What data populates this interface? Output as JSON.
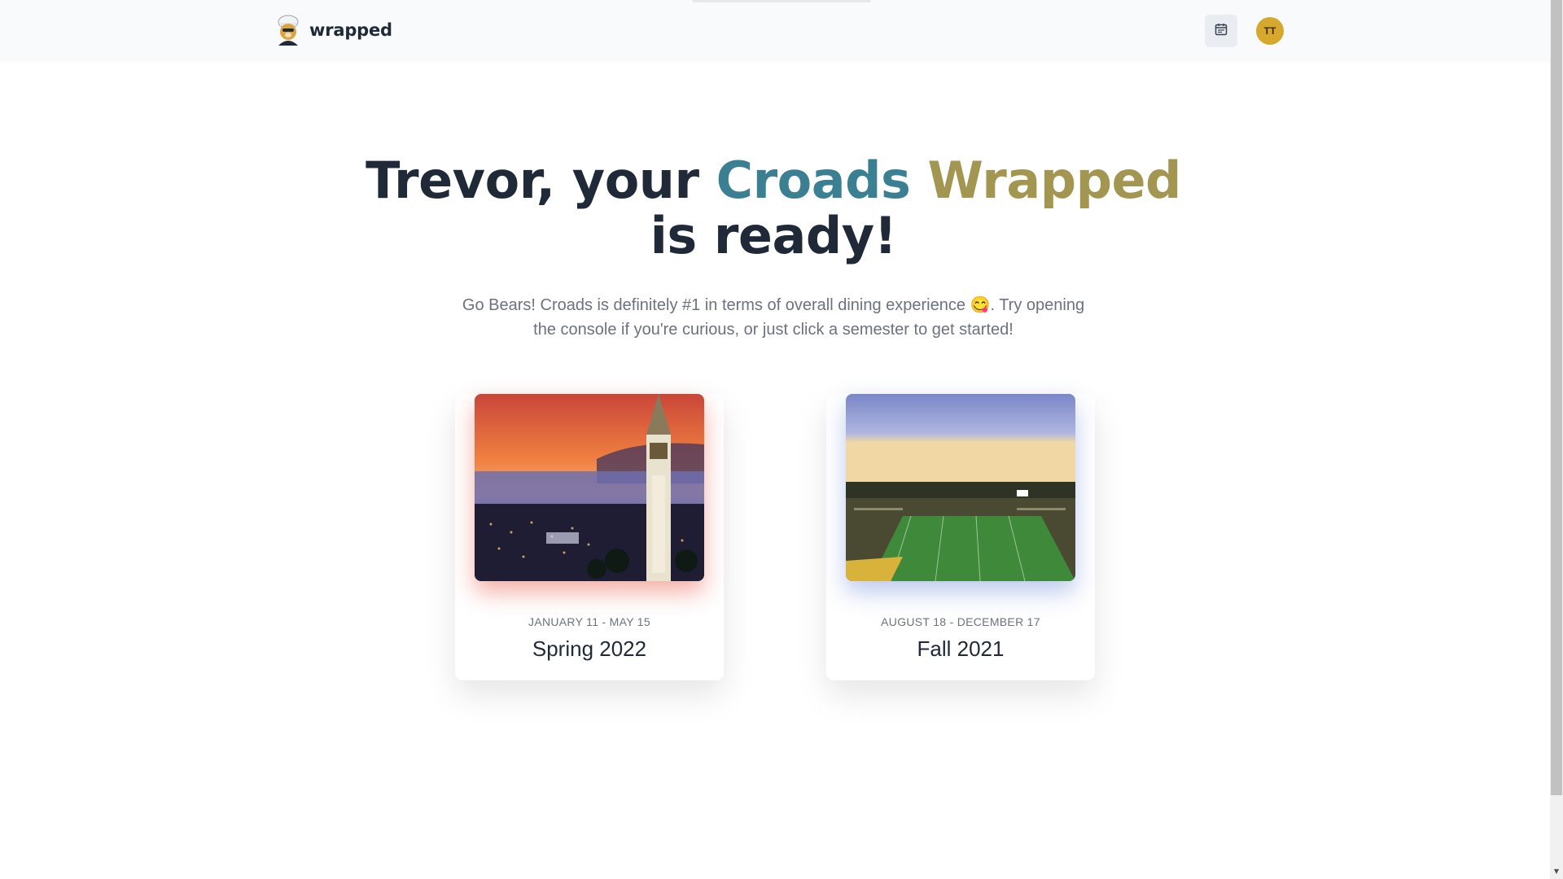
{
  "header": {
    "brand_name": "wrapped",
    "logo_icon": "bear-mascot-icon",
    "calendar_icon": "calendar-icon",
    "avatar_initials": "TT"
  },
  "hero": {
    "title_prefix": "Trevor, your ",
    "title_highlight_1": "Croads",
    "title_space": " ",
    "title_highlight_2": "Wrapped",
    "title_suffix": " is ready!",
    "subtitle": "Go Bears! Croads is definitely #1 in terms of overall dining experience 😋. Try opening the console if you're curious, or just click a semester to get started!"
  },
  "semesters": [
    {
      "dates": "JANUARY 11 - MAY 15",
      "title": "Spring 2022",
      "image_icon": "campanile-sunset-photo"
    },
    {
      "dates": "AUGUST 18 - DECEMBER 17",
      "title": "Fall 2021",
      "image_icon": "stadium-photo"
    }
  ],
  "colors": {
    "accent_teal": "#3a7f92",
    "accent_gold": "#d6a82c",
    "text_dark": "#1f2937",
    "text_muted": "#6b7280"
  }
}
